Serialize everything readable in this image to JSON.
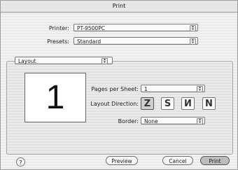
{
  "window": {
    "title": "Print"
  },
  "printer": {
    "label": "Printer:",
    "value": "PT-9500PC"
  },
  "presets": {
    "label": "Presets:",
    "value": "Standard"
  },
  "section": {
    "value": "Layout"
  },
  "preview": {
    "page_number": "1"
  },
  "layout": {
    "pages_per_sheet_label": "Pages per Sheet:",
    "pages_per_sheet_value": "1",
    "direction_label": "Layout Direction:",
    "direction_options": [
      "Z",
      "S",
      "И",
      "N"
    ],
    "direction_selected": 0,
    "border_label": "Border:",
    "border_value": "None"
  },
  "buttons": {
    "help": "?",
    "preview": "Preview",
    "cancel": "Cancel",
    "print": "Print"
  }
}
